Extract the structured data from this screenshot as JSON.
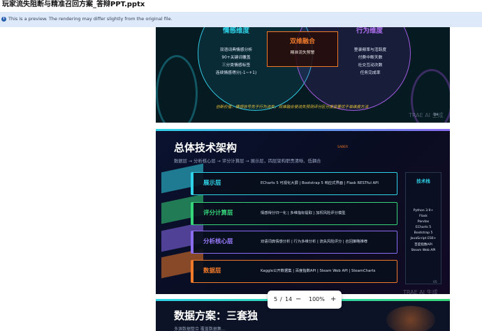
{
  "window": {
    "title": "玩家流失阻断与精准召回方案_答辩PPT.pptx"
  },
  "banner": {
    "icon": "info-icon",
    "message": "This is a preview. The rendering may differ slightly from the original file."
  },
  "slide4": {
    "left_title": "情感维度",
    "left_items": [
      "双语词典情感分析",
      "90+关键词覆盖",
      "三分类情感标签",
      "连续情感得分(-1~+1)"
    ],
    "center_title": "双维融合",
    "center_sub": "精准流失预警",
    "right_title": "行为维度",
    "right_items": [
      "登录频率与活跃度",
      "付费中断天数",
      "社交互动次数",
      "任务完成率"
    ],
    "footnote": "创新价值：情感信号先于行为流失，双维融合使流失预测评分区分度显著优于单维度方法",
    "watermark": "TRAE AI 生成",
    "page": "04"
  },
  "slide5": {
    "title": "总体技术架构",
    "subtitle": "数据层 → 分析核心层 → 评分计算层 → 展示层，四层架构职责清晰、低耦合",
    "badge": "SABER",
    "layers": [
      {
        "name": "展示层",
        "desc": "ECharts 5 可视化大屏 | Bootstrap 5 响应式界面 | Flask RESTful API",
        "color": "#2fd3e8"
      },
      {
        "name": "评分计算层",
        "desc": "情感得分归一化 | 多维指标提取 | 加权风险评分模型",
        "color": "#35d67a"
      },
      {
        "name": "分析核心层",
        "desc": "双语词典情感分析 | 行为多维分析 | 流失风险评分 | 召回策略推荐",
        "color": "#8a6cf0"
      },
      {
        "name": "数据层",
        "desc": "Kaggle公开数据集 | 百度指数API | Steam Web API | SteamCharts",
        "color": "#f07a2a"
      }
    ],
    "tech_title": "技术栈",
    "tech_items": [
      "Python 3.9+",
      "Flask",
      "Pandas",
      "ECharts 5",
      "Bootstrap 5",
      "JavaScript ES6+",
      "百度指数API",
      "Steam Web API"
    ],
    "watermark": "TRAE AI 生成",
    "page": "05"
  },
  "slide6": {
    "title": "数据方案：三套独",
    "subtitle": "多源数据整合 覆盖数据集…"
  },
  "pager": {
    "current": "5",
    "separator": "/",
    "total": "14",
    "zoom": "100%",
    "minus": "−",
    "plus": "+"
  }
}
